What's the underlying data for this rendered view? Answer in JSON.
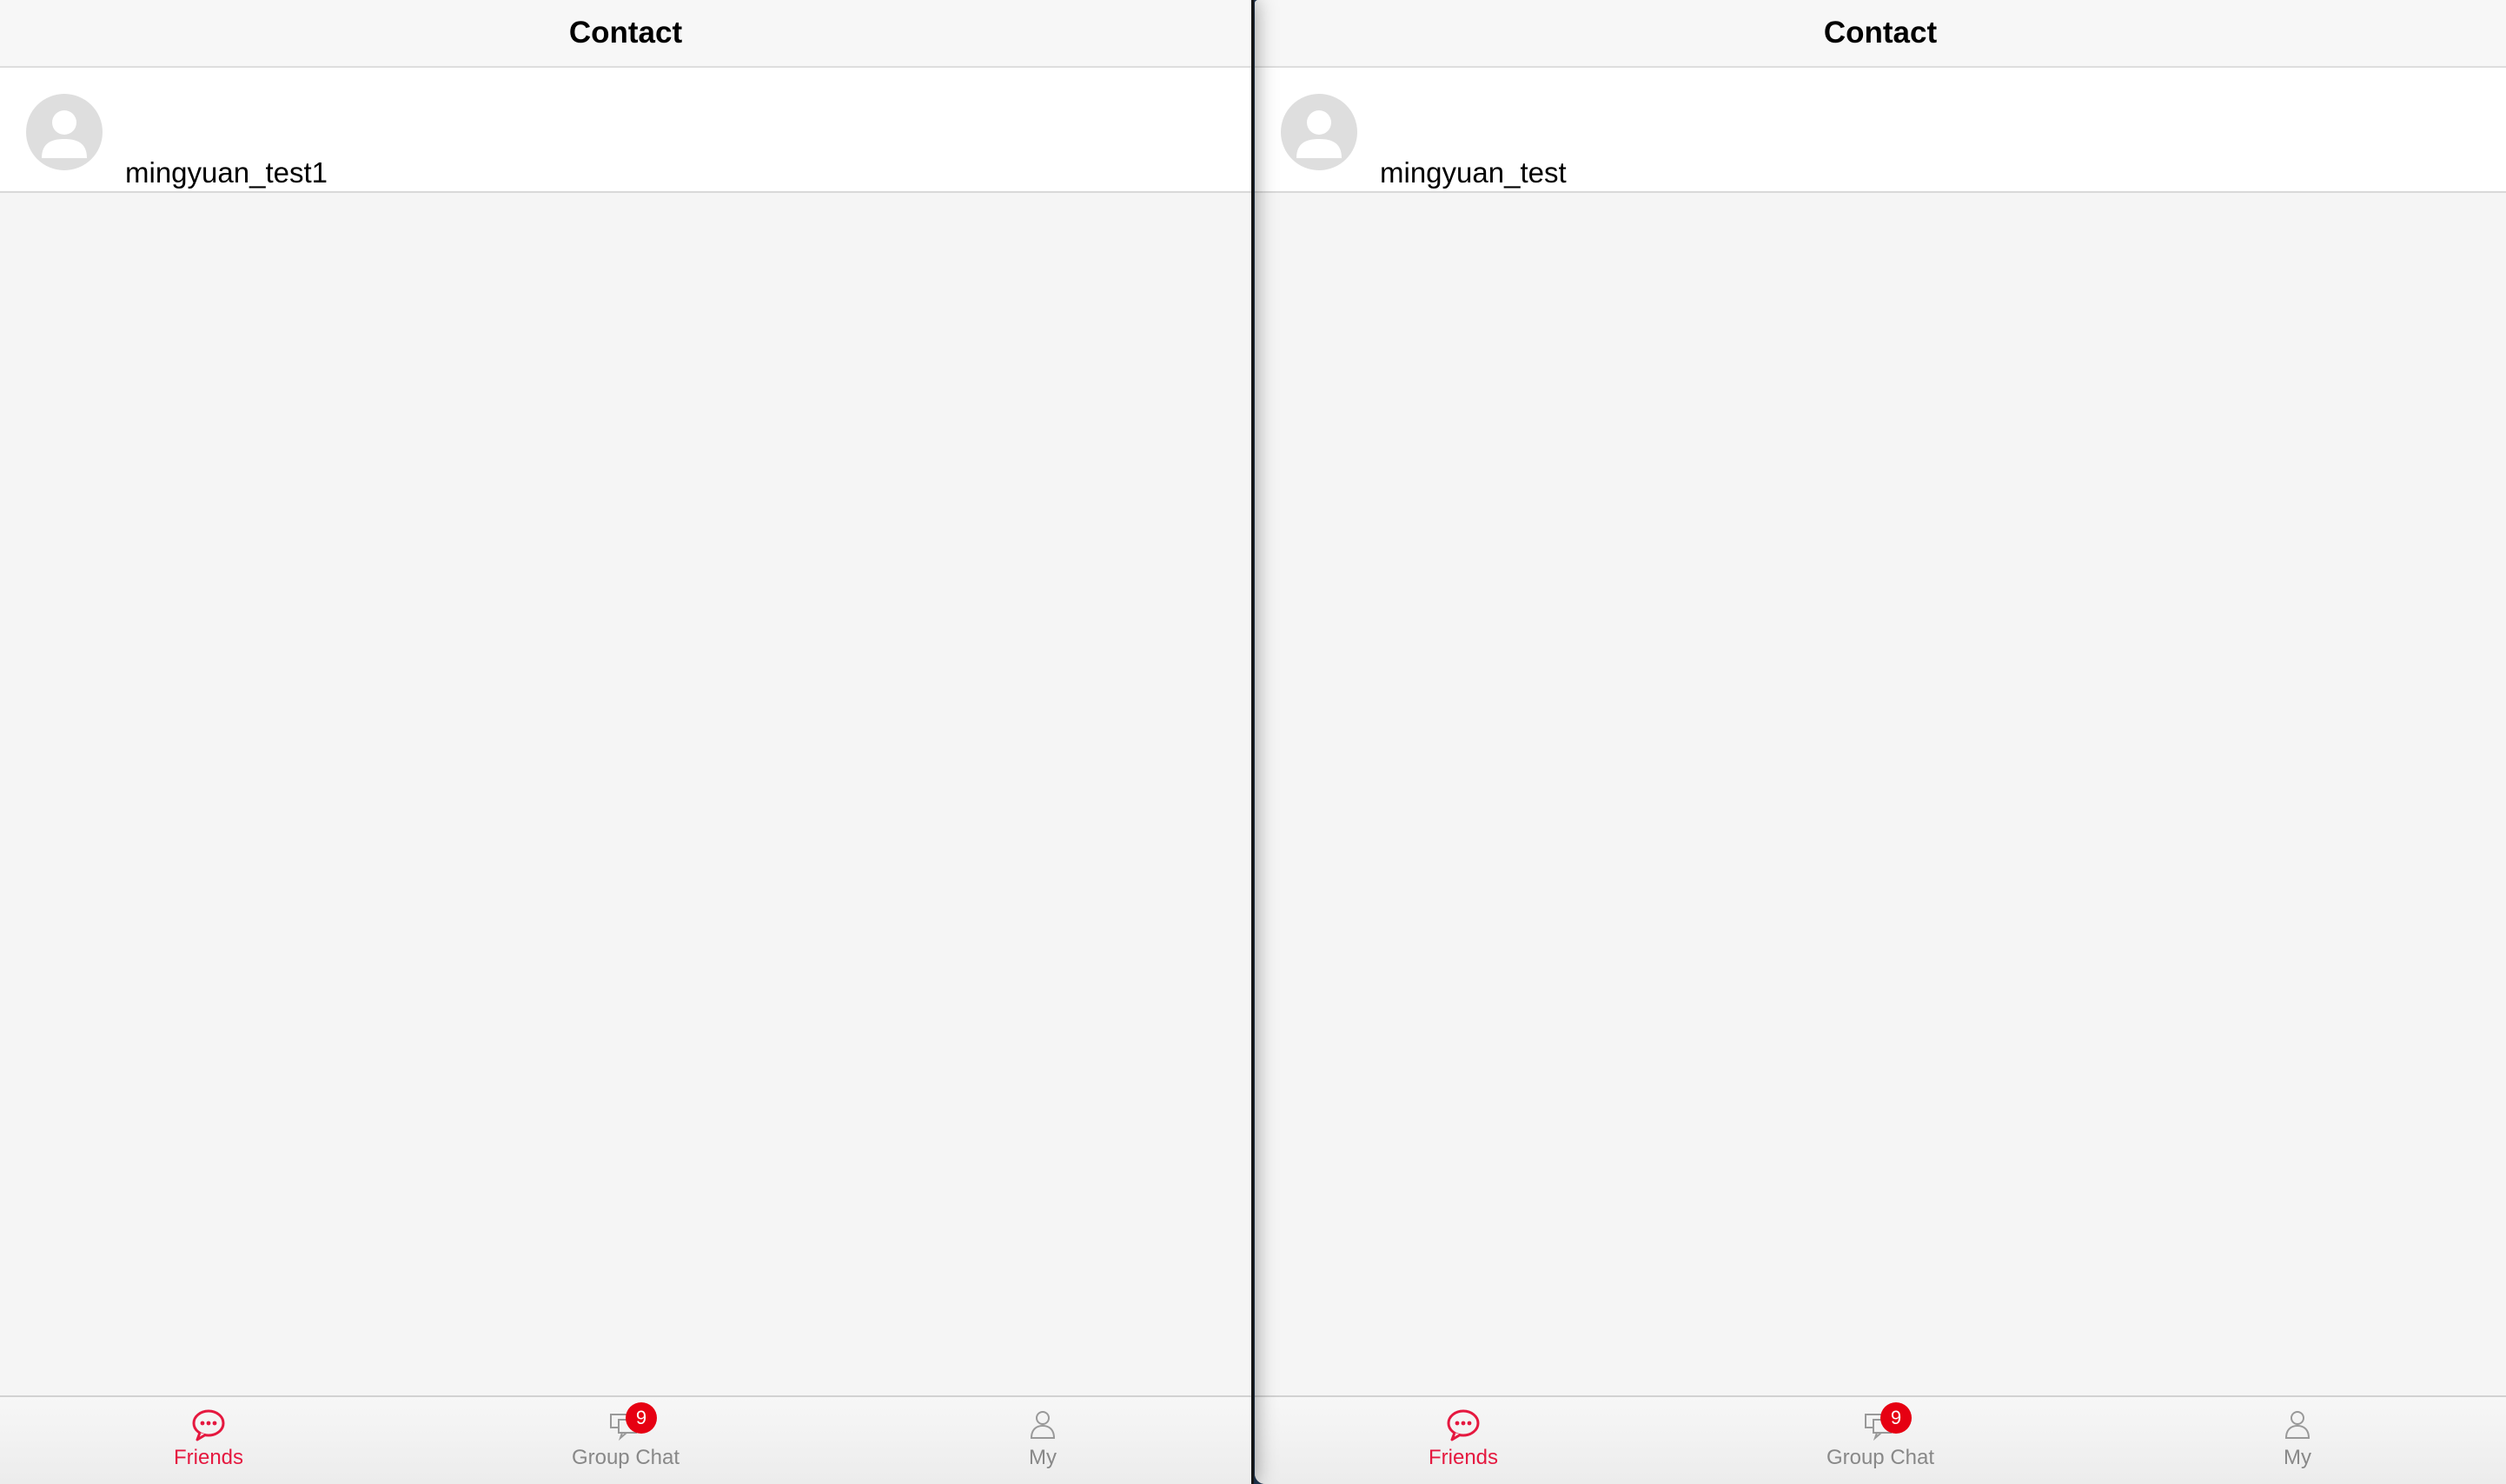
{
  "colors": {
    "accent": "#e5183f",
    "badge": "#e60012",
    "inactive": "#888888"
  },
  "panels": [
    {
      "title": "Contact",
      "contact": {
        "name": "mingyuan_test1",
        "avatar_icon": "user-placeholder-icon"
      },
      "tabs": [
        {
          "label": "Friends",
          "icon": "chat-bubble-icon",
          "active": true
        },
        {
          "label": "Group Chat",
          "icon": "group-chat-icon",
          "badge": "9"
        },
        {
          "label": "My",
          "icon": "person-icon"
        }
      ]
    },
    {
      "title": "Contact",
      "contact": {
        "name": "mingyuan_test",
        "avatar_icon": "user-placeholder-icon"
      },
      "tabs": [
        {
          "label": "Friends",
          "icon": "chat-bubble-icon",
          "active": true
        },
        {
          "label": "Group Chat",
          "icon": "group-chat-icon",
          "badge": "9"
        },
        {
          "label": "My",
          "icon": "person-icon"
        }
      ]
    }
  ]
}
